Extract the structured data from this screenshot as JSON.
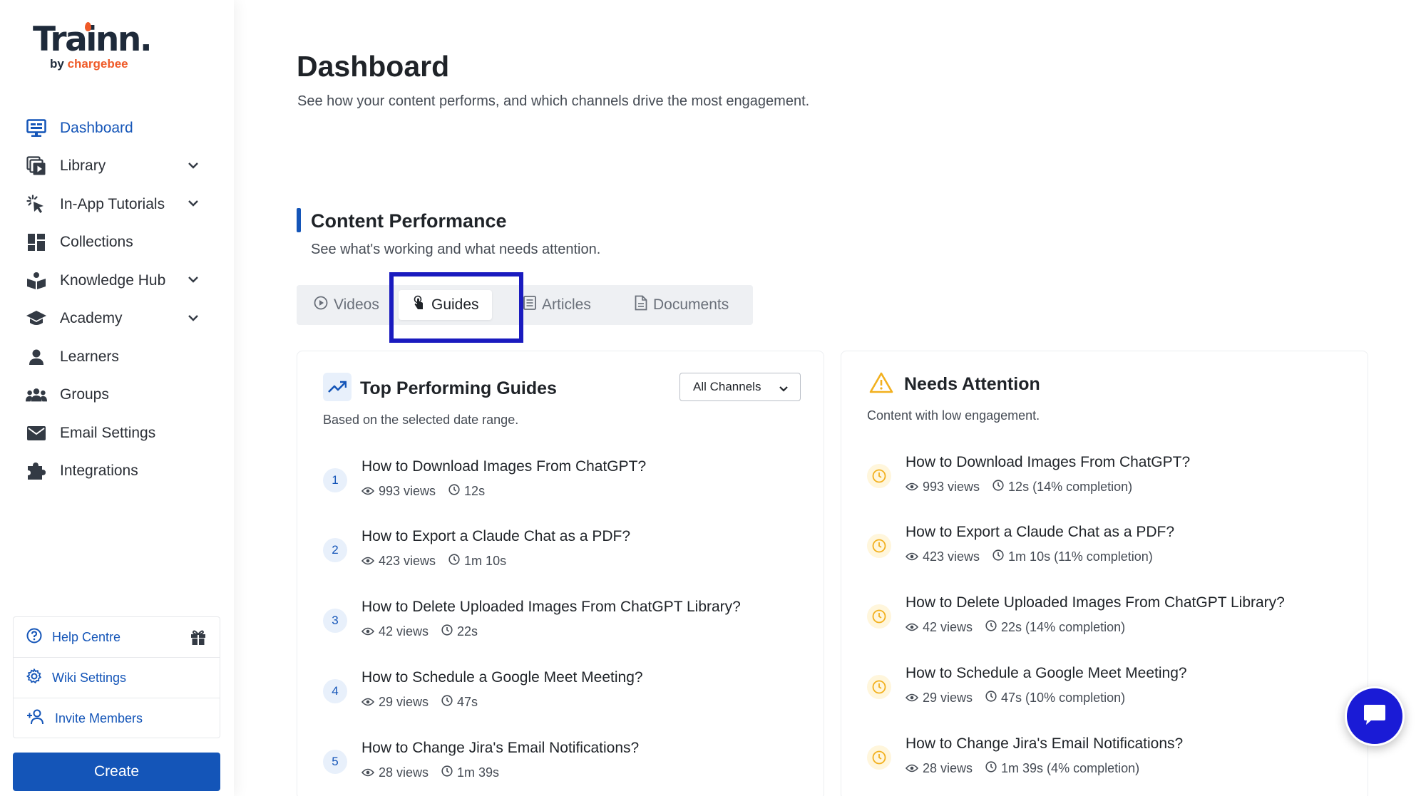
{
  "brand": {
    "name": "Trainn.",
    "by": "by",
    "company": "chargebee"
  },
  "nav": {
    "items": [
      {
        "label": "Dashboard",
        "icon": "dashboard-icon",
        "active": true,
        "expandable": false
      },
      {
        "label": "Library",
        "icon": "library-icon",
        "active": false,
        "expandable": true
      },
      {
        "label": "In-App Tutorials",
        "icon": "cursor-click-icon",
        "active": false,
        "expandable": true
      },
      {
        "label": "Collections",
        "icon": "grid-icon",
        "active": false,
        "expandable": false
      },
      {
        "label": "Knowledge Hub",
        "icon": "book-icon",
        "active": false,
        "expandable": true
      },
      {
        "label": "Academy",
        "icon": "graduation-cap-icon",
        "active": false,
        "expandable": true
      },
      {
        "label": "Learners",
        "icon": "person-icon",
        "active": false,
        "expandable": false
      },
      {
        "label": "Groups",
        "icon": "group-icon",
        "active": false,
        "expandable": false
      },
      {
        "label": "Email Settings",
        "icon": "mail-icon",
        "active": false,
        "expandable": false
      },
      {
        "label": "Integrations",
        "icon": "puzzle-icon",
        "active": false,
        "expandable": false
      }
    ]
  },
  "help_links": [
    {
      "label": "Help Centre",
      "icon": "help-circle-icon"
    },
    {
      "label": "Wiki Settings",
      "icon": "gear-icon"
    },
    {
      "label": "Invite Members",
      "icon": "add-user-icon"
    }
  ],
  "create_label": "Create",
  "header": {
    "title": "Dashboard",
    "subtitle": "See how your content performs, and which channels drive the most engagement."
  },
  "section": {
    "title": "Content Performance",
    "subtitle": "See what's working and what needs attention."
  },
  "tabs": [
    {
      "label": "Videos",
      "icon": "play-circle-icon",
      "active": false
    },
    {
      "label": "Guides",
      "icon": "touch-icon",
      "active": true
    },
    {
      "label": "Articles",
      "icon": "article-icon",
      "active": false
    },
    {
      "label": "Documents",
      "icon": "document-icon",
      "active": false
    }
  ],
  "top_card": {
    "title": "Top Performing Guides",
    "subtitle": "Based on the selected date range.",
    "channel_select": "All Channels",
    "items": [
      {
        "rank": "1",
        "title": "How to Download Images From ChatGPT?",
        "views": "993 views",
        "time": "12s"
      },
      {
        "rank": "2",
        "title": "How to Export a Claude Chat as a PDF?",
        "views": "423 views",
        "time": "1m 10s"
      },
      {
        "rank": "3",
        "title": "How to Delete Uploaded Images From ChatGPT Library?",
        "views": "42 views",
        "time": "22s"
      },
      {
        "rank": "4",
        "title": "How to Schedule a Google Meet Meeting?",
        "views": "29 views",
        "time": "47s"
      },
      {
        "rank": "5",
        "title": "How to Change Jira's Email Notifications?",
        "views": "28 views",
        "time": "1m 39s"
      }
    ]
  },
  "attention_card": {
    "title": "Needs Attention",
    "subtitle": "Content with low engagement.",
    "items": [
      {
        "title": "How to Download Images From ChatGPT?",
        "views": "993 views",
        "time": "12s (14% completion)"
      },
      {
        "title": "How to Export a Claude Chat as a PDF?",
        "views": "423 views",
        "time": "1m 10s (11% completion)"
      },
      {
        "title": "How to Delete Uploaded Images From ChatGPT Library?",
        "views": "42 views",
        "time": "22s (14% completion)"
      },
      {
        "title": "How to Schedule a Google Meet Meeting?",
        "views": "29 views",
        "time": "47s (10% completion)"
      },
      {
        "title": "How to Change Jira's Email Notifications?",
        "views": "28 views",
        "time": "1m 39s (4% completion)"
      }
    ]
  },
  "colors": {
    "primary": "#1455b8",
    "highlight": "#1a1bbf",
    "warning": "#f2b01e",
    "brand_accent": "#ef5a28"
  }
}
